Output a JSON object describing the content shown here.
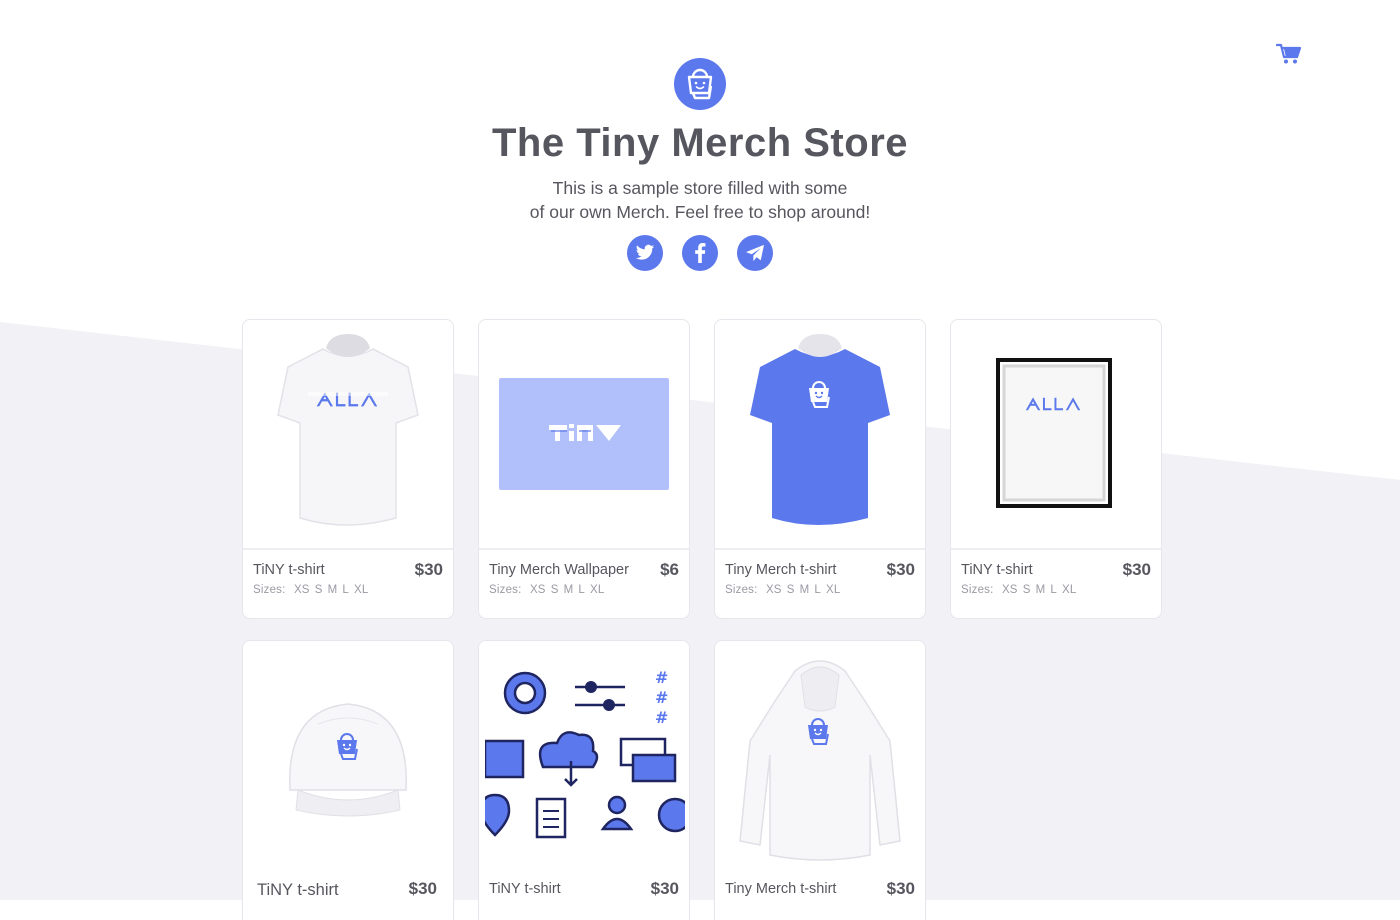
{
  "store": {
    "title": "The Tiny Merch Store",
    "subtitle_line1": "This is a sample store filled with some",
    "subtitle_line2": "of our own Merch. Feel free to shop around!"
  },
  "icons": {
    "cart": "cart-icon",
    "logo": "shopping-bag-icon",
    "social": [
      "twitter-icon",
      "facebook-icon",
      "telegram-icon"
    ]
  },
  "colors": {
    "accent": "#5b78ec",
    "text": "#56565e",
    "muted": "#9a9aa4",
    "background_band": "#f1f1f6"
  },
  "sizes_label": "Sizes:",
  "products": [
    {
      "name": "TiNY t-shirt",
      "price": "$30",
      "sizes": [
        "XS",
        "S",
        "M",
        "L",
        "XL"
      ],
      "image": "white-tshirt"
    },
    {
      "name": "Tiny Merch Wallpaper",
      "price": "$6",
      "sizes": [
        "XS",
        "S",
        "M",
        "L",
        "XL"
      ],
      "image": "wallpaper"
    },
    {
      "name": "Tiny Merch t-shirt",
      "price": "$30",
      "sizes": [
        "XS",
        "S",
        "M",
        "L",
        "XL"
      ],
      "image": "blue-tshirt"
    },
    {
      "name": "TiNY t-shirt",
      "price": "$30",
      "sizes": [
        "XS",
        "S",
        "M",
        "L",
        "XL"
      ],
      "image": "framed-poster"
    },
    {
      "name": "TiNY t-shirt",
      "price": "$30",
      "image": "white-cap"
    },
    {
      "name": "TiNY t-shirt",
      "price": "$30",
      "image": "icon-set"
    },
    {
      "name": "Tiny Merch t-shirt",
      "price": "$30",
      "image": "white-hoodie"
    }
  ]
}
